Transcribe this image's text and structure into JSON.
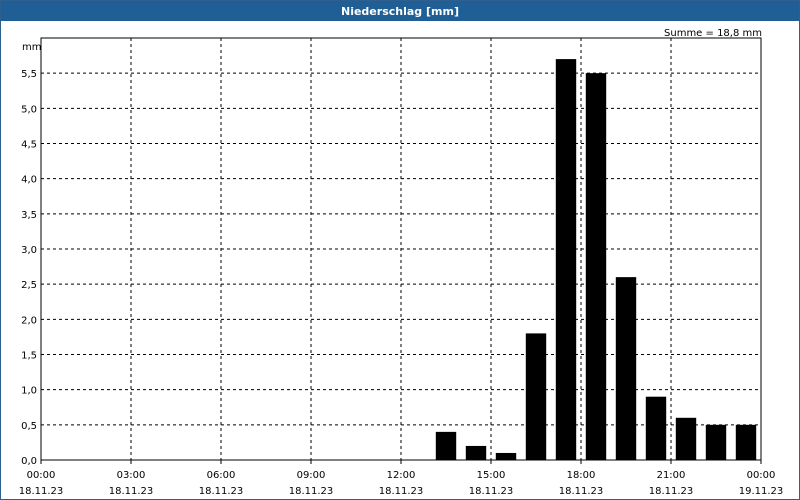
{
  "chart_data": {
    "type": "bar",
    "title": "Niederschlag [mm]",
    "unit_label": "mm",
    "annotation": "Summe = 18,8 mm",
    "ylim": [
      0,
      6.0
    ],
    "yticks": [
      "0,0",
      "0,5",
      "1,0",
      "1,5",
      "2,0",
      "2,5",
      "3,0",
      "3,5",
      "4,0",
      "4,5",
      "5,0",
      "5,5"
    ],
    "xlim": [
      "18.11.23 00:00",
      "19.11.23 00:00"
    ],
    "xticks": [
      {
        "time": "00:00",
        "date": "18.11.23"
      },
      {
        "time": "03:00",
        "date": "18.11.23"
      },
      {
        "time": "06:00",
        "date": "18.11.23"
      },
      {
        "time": "09:00",
        "date": "18.11.23"
      },
      {
        "time": "12:00",
        "date": "18.11.23"
      },
      {
        "time": "15:00",
        "date": "18.11.23"
      },
      {
        "time": "18:00",
        "date": "18.11.23"
      },
      {
        "time": "21:00",
        "date": "18.11.23"
      },
      {
        "time": "00:00",
        "date": "19.11.23"
      }
    ],
    "grid": true,
    "bar_color": "#000000",
    "categories": [
      "13:00",
      "14:00",
      "15:00",
      "16:00",
      "17:00",
      "18:00",
      "19:00",
      "20:00",
      "21:00",
      "22:00",
      "23:00"
    ],
    "values": [
      0.4,
      0.2,
      0.1,
      1.8,
      5.7,
      5.5,
      2.6,
      0.9,
      0.6,
      0.5,
      0.5
    ]
  }
}
